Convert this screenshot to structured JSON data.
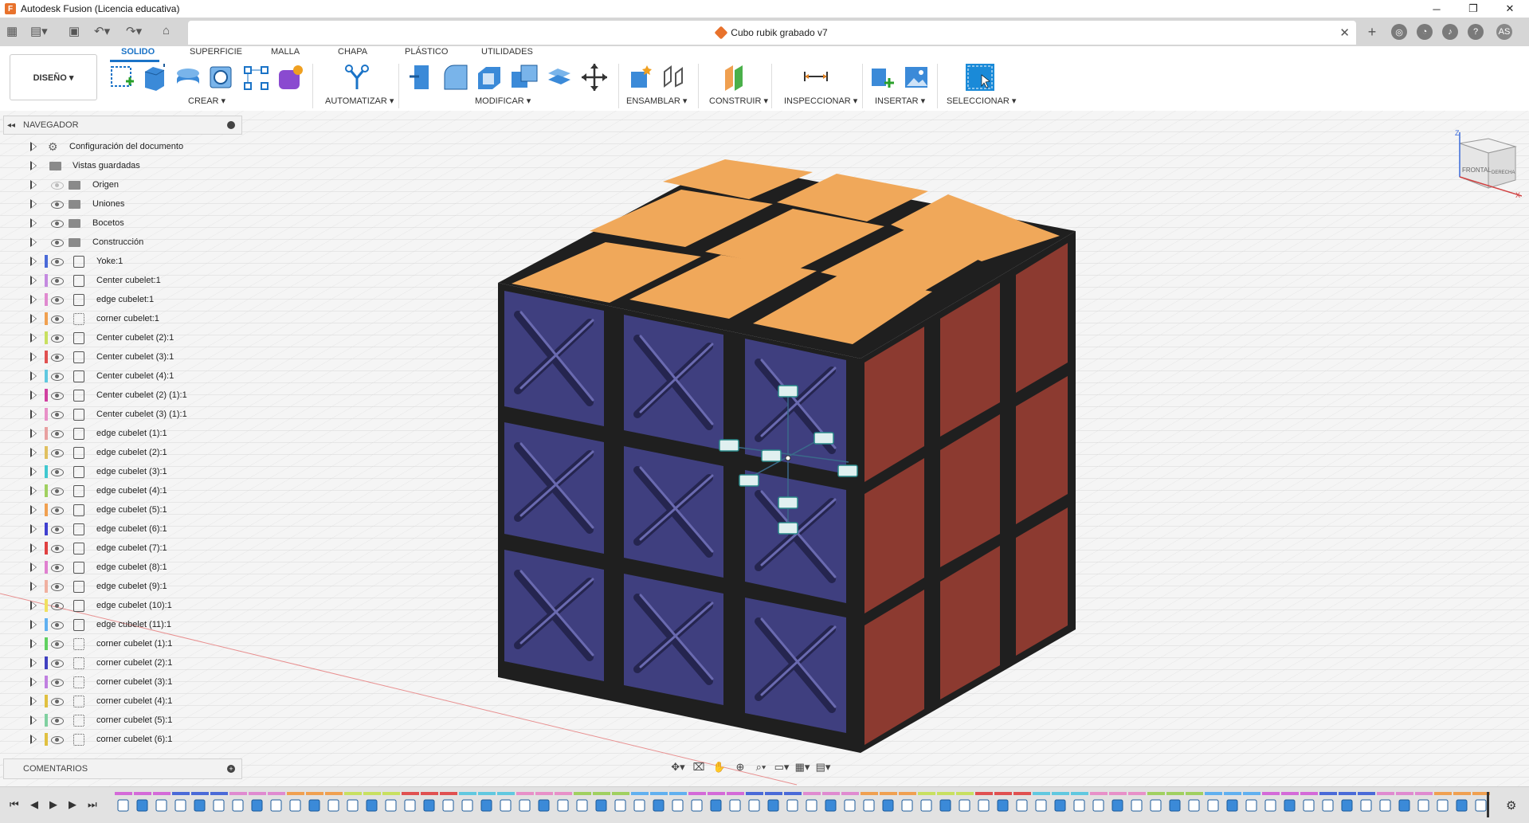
{
  "app": {
    "title": "Autodesk Fusion (Licencia educativa)",
    "logo_letter": "F"
  },
  "window_controls": {
    "minimize": "─",
    "restore": "❐",
    "close": "✕"
  },
  "document": {
    "title": "Cubo rubik grabado v7",
    "close": "✕"
  },
  "user": {
    "initials": "AS"
  },
  "ribbon": {
    "design_button": "DISEÑO ▾",
    "tabs": [
      "SOLIDO",
      "SUPERFICIE",
      "MALLA",
      "CHAPA",
      "PLÁSTICO",
      "UTILIDADES"
    ],
    "active_tab": "SOLIDO",
    "groups": [
      "CREAR ▾",
      "AUTOMATIZAR ▾",
      "MODIFICAR ▾",
      "ENSAMBLAR ▾",
      "CONSTRUIR ▾",
      "INSPECCIONAR ▾",
      "INSERTAR ▾",
      "SELECCIONAR ▾"
    ]
  },
  "browser": {
    "header": "NAVEGADOR",
    "items": [
      {
        "label": "Configuración del documento",
        "kind": "settings"
      },
      {
        "label": "Vistas guardadas",
        "kind": "folder-plain"
      },
      {
        "label": "Origen",
        "kind": "folder-hidden"
      },
      {
        "label": "Uniones",
        "kind": "folder"
      },
      {
        "label": "Bocetos",
        "kind": "folder"
      },
      {
        "label": "Construcción",
        "kind": "folder"
      },
      {
        "label": "Yoke:1",
        "kind": "body",
        "color": "#4a6ad8"
      },
      {
        "label": "Center cubelet:1",
        "kind": "body",
        "color": "#c48ae0"
      },
      {
        "label": "edge cubelet:1",
        "kind": "body",
        "color": "#e08ad0"
      },
      {
        "label": "corner cubelet:1",
        "kind": "body-link",
        "color": "#f0a050"
      },
      {
        "label": "Center cubelet (2):1",
        "kind": "body",
        "color": "#c8e060"
      },
      {
        "label": "Center cubelet (3):1",
        "kind": "body",
        "color": "#e05050"
      },
      {
        "label": "Center cubelet (4):1",
        "kind": "body",
        "color": "#60c8e0"
      },
      {
        "label": "Center cubelet (2) (1):1",
        "kind": "body",
        "color": "#d040a0"
      },
      {
        "label": "Center cubelet (3) (1):1",
        "kind": "body",
        "color": "#e890c8"
      },
      {
        "label": "edge cubelet (1):1",
        "kind": "body",
        "color": "#e8a0a0"
      },
      {
        "label": "edge cubelet (2):1",
        "kind": "body",
        "color": "#e0c060"
      },
      {
        "label": "edge cubelet (3):1",
        "kind": "body",
        "color": "#40c8d0"
      },
      {
        "label": "edge cubelet (4):1",
        "kind": "body",
        "color": "#a0d060"
      },
      {
        "label": "edge cubelet (5):1",
        "kind": "body",
        "color": "#f0a050"
      },
      {
        "label": "edge cubelet (6):1",
        "kind": "body",
        "color": "#4040d0"
      },
      {
        "label": "edge cubelet (7):1",
        "kind": "body",
        "color": "#e04040"
      },
      {
        "label": "edge cubelet (8):1",
        "kind": "body",
        "color": "#e080d0"
      },
      {
        "label": "edge cubelet (9):1",
        "kind": "body",
        "color": "#f0b0a0"
      },
      {
        "label": "edge cubelet (10):1",
        "kind": "body",
        "color": "#f0e060"
      },
      {
        "label": "edge cubelet (11):1",
        "kind": "body",
        "color": "#60b0f0"
      },
      {
        "label": "corner cubelet (1):1",
        "kind": "body-link",
        "color": "#60d060"
      },
      {
        "label": "corner cubelet (2):1",
        "kind": "body-link",
        "color": "#4040c0"
      },
      {
        "label": "corner cubelet (3):1",
        "kind": "body-link",
        "color": "#c080e0"
      },
      {
        "label": "corner cubelet (4):1",
        "kind": "body-link",
        "color": "#e0c040"
      },
      {
        "label": "corner cubelet (5):1",
        "kind": "body-link",
        "color": "#80d0a0"
      },
      {
        "label": "corner cubelet (6):1",
        "kind": "body-link",
        "color": "#e0c040"
      }
    ],
    "comments": "COMENTARIOS"
  },
  "viewcube": {
    "front": "FRONTAL",
    "right": "DERECHA",
    "z": "Z",
    "x": "X"
  },
  "timeline": {
    "controls": [
      "⏮",
      "◀",
      "▶",
      "▶",
      "⏭"
    ]
  },
  "colors": {
    "top": "#f0a85a",
    "front": "#3f3f7f",
    "right": "#8c3a30",
    "frame": "#1f1f1f",
    "accent": "#1a73c7"
  }
}
